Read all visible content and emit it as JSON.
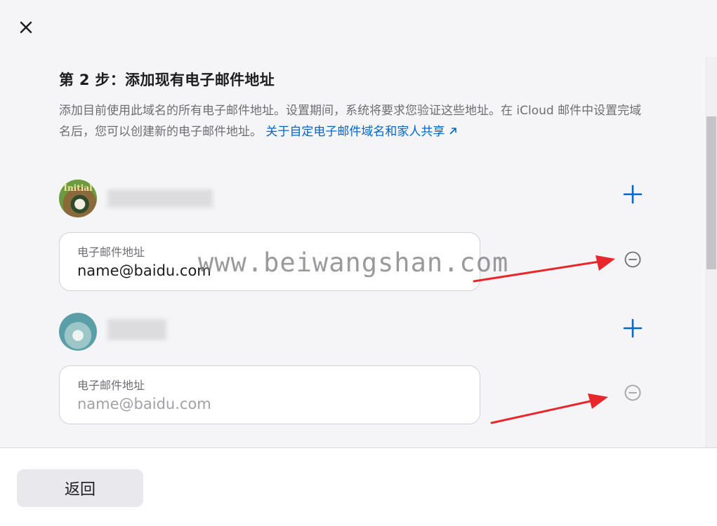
{
  "header": {
    "close_icon": "close-icon"
  },
  "step": {
    "title": "第 2 步：添加现有电子邮件地址",
    "description": "添加目前使用此域名的所有电子邮件地址。设置期间，系统将要求您验证这些地址。在 iCloud 邮件中设置完域名后，您可以创建新的电子邮件地址。",
    "link_label": "关于自定电子邮件域名和家人共享",
    "link_icon": "arrow-up-right-icon"
  },
  "members": [
    {
      "avatar_text": "Initial",
      "email_label": "电子邮件地址",
      "email_value": "name@baidu.com",
      "add_icon": "plus-icon",
      "remove_icon": "minus-circle-icon"
    },
    {
      "email_label": "电子邮件地址",
      "email_placeholder": "name@baidu.com",
      "add_icon": "plus-icon",
      "remove_icon": "minus-circle-icon"
    }
  ],
  "watermark": "www.beiwangshan.com",
  "footer": {
    "back_label": "返回"
  },
  "colors": {
    "accent": "#0066cc",
    "annotation_arrow": "#e8262b",
    "background": "#f5f5f7"
  }
}
